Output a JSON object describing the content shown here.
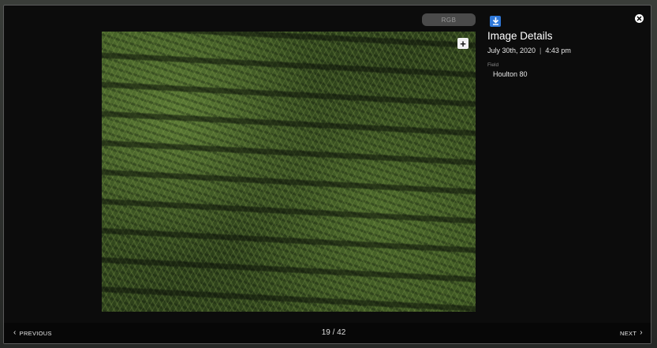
{
  "viewer": {
    "mode_toggle_label": "RGB",
    "zoom_icon": "plus-icon",
    "download_icon": "download-icon",
    "close_icon": "close-icon"
  },
  "details": {
    "title": "Image Details",
    "date": "July 30th, 2020",
    "separator": "|",
    "time": "4:43 pm",
    "field_label": "Field",
    "field_value": "Houlton 80"
  },
  "navigation": {
    "previous_label": "PREVIOUS",
    "next_label": "NEXT",
    "current": "19",
    "total": "42",
    "page_text": "19 / 42"
  },
  "colors": {
    "accent": "#2f78d8",
    "background": "#0c0c0c",
    "text": "#ffffff"
  }
}
